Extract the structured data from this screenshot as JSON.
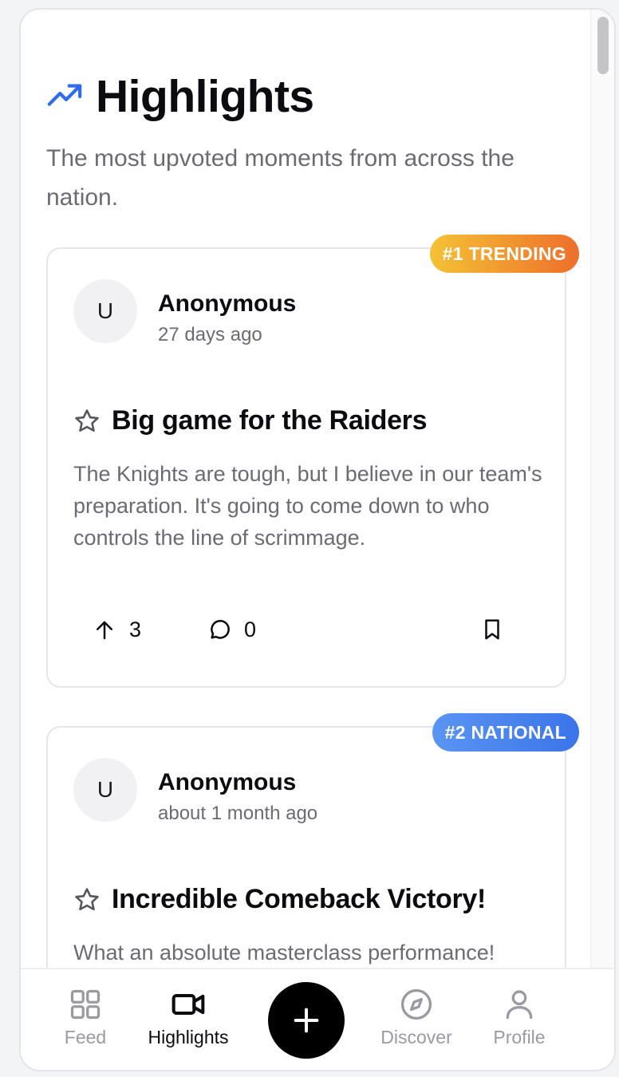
{
  "page": {
    "title": "Highlights",
    "title_icon": "trending-up-icon",
    "subtitle": "The most upvoted moments from across the nation."
  },
  "colors": {
    "accent_blue": "#2f6bea",
    "trending_gradient": [
      "#f4c234",
      "#ee6f2c"
    ],
    "national_gradient": [
      "#5a95f2",
      "#3b74ea"
    ],
    "text_primary": "#0b0b10",
    "text_muted": "#6b6b73"
  },
  "posts": [
    {
      "badge": "#1 TRENDING",
      "avatar_initial": "U",
      "author": "Anonymous",
      "time": "27 days ago",
      "title": "Big game for the Raiders",
      "body": "The Knights are tough, but I believe in our team's preparation. It's going to come down to who controls the line of scrimmage.",
      "upvotes": "3",
      "comments": "0"
    },
    {
      "badge": "#2 NATIONAL",
      "avatar_initial": "U",
      "author": "Anonymous",
      "time": "about 1 month ago",
      "title": "Incredible Comeback Victory!",
      "body": "What an absolute masterclass performance!"
    }
  ],
  "tabbar": {
    "feed": "Feed",
    "highlights": "Highlights",
    "discover": "Discover",
    "profile": "Profile",
    "active": "highlights"
  }
}
